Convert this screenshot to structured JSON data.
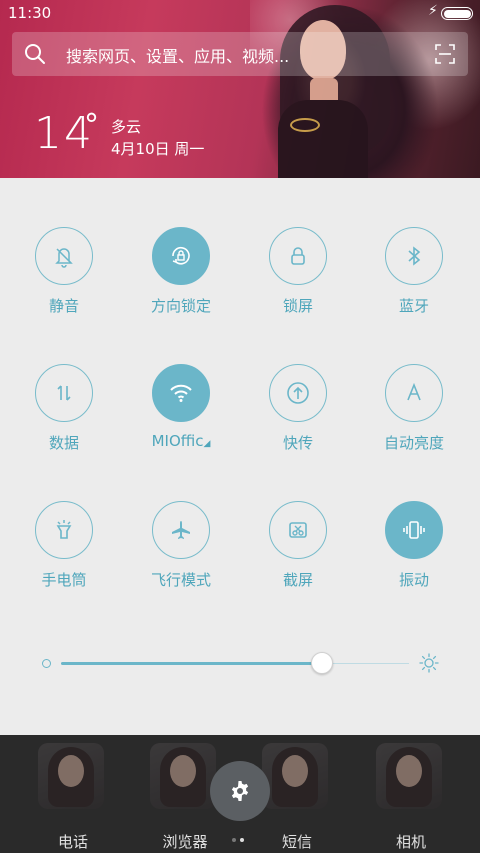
{
  "status_bar": {
    "time": "11:30",
    "charging_icon": "lightning-bolt-icon",
    "battery_level": 1.0
  },
  "search": {
    "placeholder": "搜索网页、设置、应用、视频..."
  },
  "weather": {
    "temperature": "14",
    "degree_symbol": "°",
    "condition": "多云",
    "date": "4月10日 周一"
  },
  "toggles": [
    {
      "label": "静音",
      "icon": "bell-off-icon",
      "on": false
    },
    {
      "label": "方向锁定",
      "icon": "rotation-lock-icon",
      "on": true
    },
    {
      "label": "锁屏",
      "icon": "lock-icon",
      "on": false
    },
    {
      "label": "蓝牙",
      "icon": "bluetooth-icon",
      "on": false
    },
    {
      "label": "数据",
      "icon": "mobile-data-icon",
      "on": false
    },
    {
      "label": "MIOffic",
      "icon": "wifi-icon",
      "on": true
    },
    {
      "label": "快传",
      "icon": "upload-icon",
      "on": false
    },
    {
      "label": "自动亮度",
      "icon": "auto-brightness-icon",
      "on": false
    },
    {
      "label": "手电筒",
      "icon": "flashlight-icon",
      "on": false
    },
    {
      "label": "飞行模式",
      "icon": "airplane-icon",
      "on": false
    },
    {
      "label": "截屏",
      "icon": "screenshot-icon",
      "on": false
    },
    {
      "label": "振动",
      "icon": "vibrate-icon",
      "on": true
    }
  ],
  "brightness": {
    "level": 0.75
  },
  "dock": {
    "apps": [
      {
        "label": "电话"
      },
      {
        "label": "浏览器"
      },
      {
        "label": "短信"
      },
      {
        "label": "相机"
      }
    ],
    "settings_icon": "gear-icon",
    "page_count": 2,
    "active_page": 2
  },
  "colors": {
    "accent": "#6bb6c9",
    "panel_bg": "#ececec",
    "header_pink": "#c63a5c"
  }
}
